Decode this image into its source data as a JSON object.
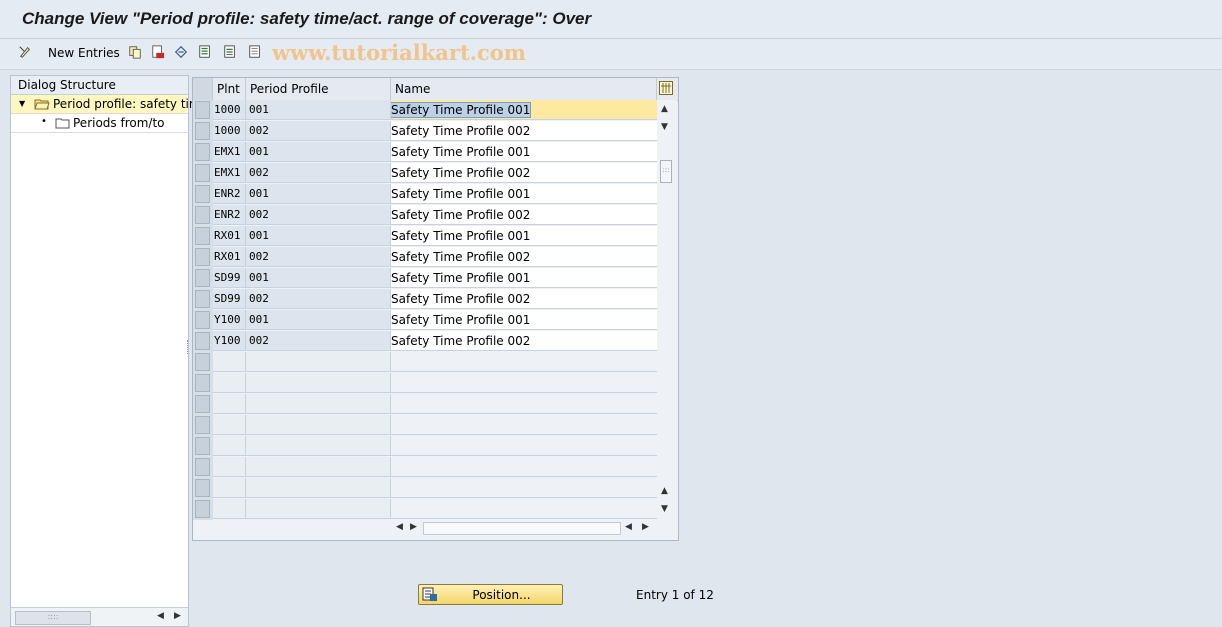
{
  "window": {
    "title": "Change View \"Period profile: safety time/act. range of coverage\": Over"
  },
  "toolbar": {
    "new_entries_label": "New Entries",
    "watermark": "www.tutorialkart.com",
    "icons": [
      "change-display-icon",
      "copy-icon",
      "delete-icon",
      "undo-icon",
      "select-all-icon",
      "select-block-icon",
      "deselect-all-icon"
    ]
  },
  "dialog_structure": {
    "heading": "Dialog Structure",
    "items": [
      {
        "label": "Period profile: safety tim",
        "selected": true,
        "level": 0
      },
      {
        "label": "Periods from/to",
        "selected": false,
        "level": 1
      }
    ]
  },
  "table": {
    "columns": [
      "Plnt",
      "Period Profile",
      "Name"
    ],
    "rows": [
      {
        "plnt": "1000",
        "profile": "001",
        "name": "Safety Time Profile 001"
      },
      {
        "plnt": "1000",
        "profile": "002",
        "name": "Safety Time Profile 002"
      },
      {
        "plnt": "EMX1",
        "profile": "001",
        "name": "Safety Time Profile 001"
      },
      {
        "plnt": "EMX1",
        "profile": "002",
        "name": "Safety Time Profile 002"
      },
      {
        "plnt": "ENR2",
        "profile": "001",
        "name": "Safety Time Profile 001"
      },
      {
        "plnt": "ENR2",
        "profile": "002",
        "name": "Safety Time Profile 002"
      },
      {
        "plnt": "RX01",
        "profile": "001",
        "name": "Safety Time Profile 001"
      },
      {
        "plnt": "RX01",
        "profile": "002",
        "name": "Safety Time Profile 002"
      },
      {
        "plnt": "SD99",
        "profile": "001",
        "name": "Safety Time Profile 001"
      },
      {
        "plnt": "SD99",
        "profile": "002",
        "name": "Safety Time Profile 002"
      },
      {
        "plnt": "Y100",
        "profile": "001",
        "name": "Safety Time Profile 001"
      },
      {
        "plnt": "Y100",
        "profile": "002",
        "name": "Safety Time Profile 002"
      }
    ],
    "empty_rows": 8
  },
  "footer": {
    "position_button": "Position...",
    "entry_info": "Entry 1 of 12"
  },
  "colors": {
    "background": "#dfe6ee",
    "key_column": "#dce5ee",
    "focus_cell": "#ffe9a0",
    "selected_tree": "#fff7c0",
    "position_button": "#f3d56a"
  }
}
